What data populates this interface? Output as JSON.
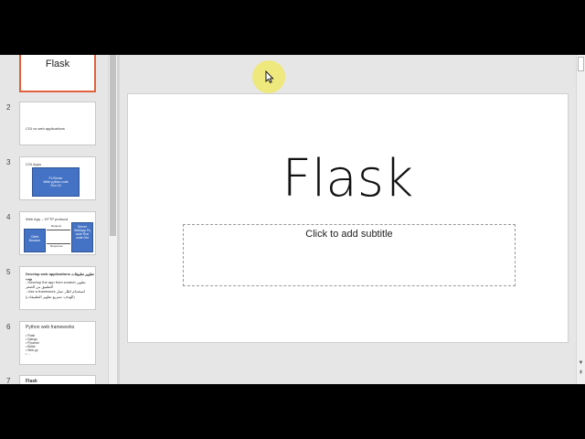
{
  "thumbnails": [
    {
      "num": "",
      "title": "Flask",
      "selected": true
    },
    {
      "num": "2",
      "text": "CGI vs web applications"
    },
    {
      "num": "3",
      "heading": "CGI Apps",
      "box": "PL/Server\nWrite python code\nRun Cli"
    },
    {
      "num": "4",
      "heading": "Web App – HTTP protocol",
      "client": "Client Browser",
      "server": "Server WebApp Py code Run code Get",
      "request": "Request",
      "response": "Response"
    },
    {
      "num": "5",
      "lines": [
        "Develop web applications تطوير تطبيقات ويب",
        "- Develop the app from scratch تطوير التطبيق من الصفر",
        "- Use a framework استخدام اطار عمل",
        "(الهدف: تسريع تطوير التطبيقات)"
      ]
    },
    {
      "num": "6",
      "heading": "Python web frameworks",
      "items": [
        "• Flask",
        "• Django",
        "• Pyramid",
        "• Bottle",
        "• Web.py",
        "• ..."
      ]
    },
    {
      "num": "7",
      "heading": "Flask"
    }
  ],
  "slide": {
    "title": "Flask",
    "subtitle_placeholder": "Click to add subtitle"
  }
}
